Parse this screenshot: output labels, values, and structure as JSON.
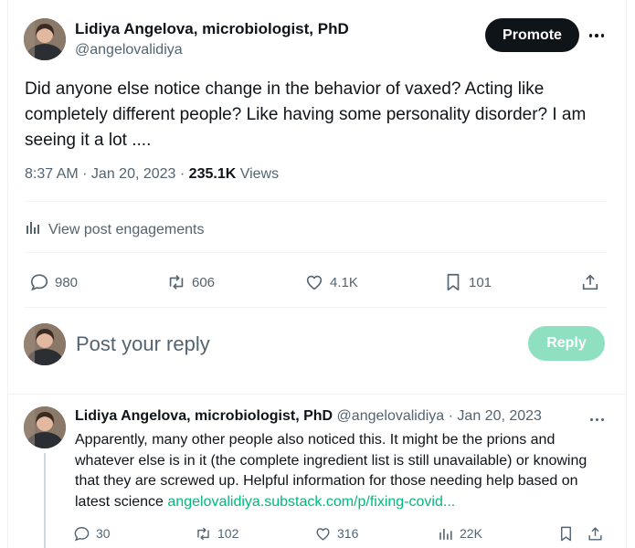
{
  "post": {
    "author_name": "Lidiya Angelova, microbiologist, PhD",
    "author_handle": "@angelovalidiya",
    "promote_label": "Promote",
    "text": "Did anyone else notice change in the behavior of vaxed? Acting like completely different people? Like having some personality disorder? I am seeing it a lot ....",
    "time": "8:37 AM · Jan 20, 2023 · ",
    "views_count": "235.1K",
    "views_label": " Views",
    "engagements_label": "View post engagements",
    "stats": {
      "replies": "980",
      "reposts": "606",
      "likes": "4.1K",
      "bookmarks": "101"
    }
  },
  "composer": {
    "placeholder": "Post your reply",
    "reply_label": "Reply"
  },
  "reply": {
    "author_name": "Lidiya Angelova, microbiologist, PhD",
    "author_handle": " @angelovalidiya",
    "date": " · Jan 20, 2023",
    "text": "Apparently, many other people also noticed this. It might be the prions and whatever else is in it (the complete ingredient list is still unavailable) or knowing that they are screwed up. Helpful information for those needing help based on latest science ",
    "link_text": "angelovalidiya.substack.com/p/fixing-covid...",
    "stats": {
      "replies": "30",
      "reposts": "102",
      "likes": "316",
      "views": "22K"
    }
  },
  "colors": {
    "accent_green": "#00ba7c",
    "reply_button": "#8fe0c0",
    "muted": "#536471"
  },
  "icons": [
    "avatar-photo",
    "more-icon",
    "analytics-icon",
    "reply-icon",
    "repost-icon",
    "like-icon",
    "bookmark-icon",
    "share-icon",
    "views-icon"
  ]
}
